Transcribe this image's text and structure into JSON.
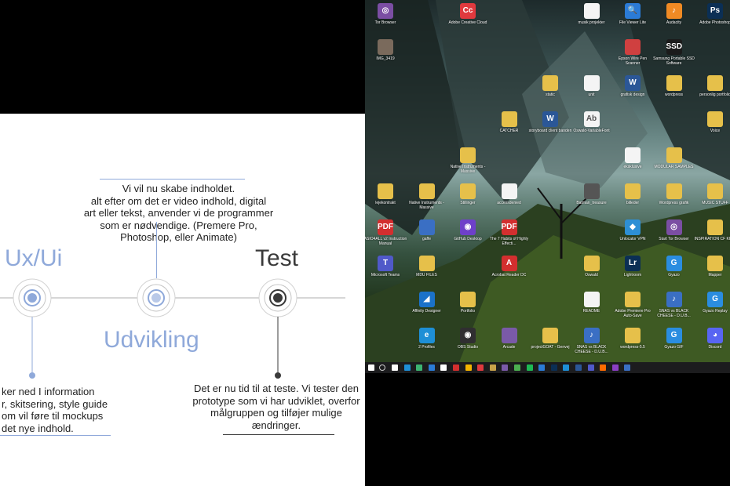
{
  "slide": {
    "top_text": "Vi vil nu skabe indholdet.\nalt efter om det er video indhold, digital\nart eller tekst, anvender vi de programmer\nsom er nødvendige. (Premere Pro,\nPhotoshop, eller Animate)",
    "phase1_title": "Ux/Ui",
    "phase2_title": "Udvikling",
    "phase3_title": "Test",
    "left_text": "ker ned I information\nr, skitsering, style guide\nom vil føre til mockups\n det nye indhold.",
    "right_text": "Det er nu tid til at teste. Vi tester den\nprototype som vi har udviklet, overfor\nmålgruppen og tilføjer mulige\nændringer.",
    "colors": {
      "blue": "#8fa9da",
      "dark": "#3a3a3a",
      "line": "#bfbfbf"
    }
  },
  "desktop": {
    "icons": [
      {
        "label": "Tor Browser",
        "glyph": "◎",
        "type": "app",
        "color": "#7b4ea3"
      },
      {
        "label": "Adobe Creative Cloud",
        "glyph": "Cc",
        "type": "app",
        "color": "#e0393e"
      },
      {
        "label": "musik projekter",
        "glyph": "",
        "type": "doc",
        "color": "#f4f4f4"
      },
      {
        "label": "File Viewer Lite",
        "glyph": "🔍",
        "type": "app",
        "color": "#2b7bd6"
      },
      {
        "label": "Audacity",
        "glyph": "♪",
        "type": "app",
        "color": "#f08a24"
      },
      {
        "label": "Adobe Photoshop",
        "glyph": "Ps",
        "type": "app",
        "color": "#0b2f55"
      },
      {
        "label": "IMG_3419",
        "glyph": "",
        "type": "app",
        "color": "#7a6a5c"
      },
      {
        "label": "Epson Wire Pen Scanner",
        "glyph": "",
        "type": "app",
        "color": "#d04040"
      },
      {
        "label": "Samsung Portable SSD Software",
        "glyph": "SSD",
        "type": "app",
        "color": "#1b1b1b"
      },
      {
        "label": "static",
        "glyph": "",
        "type": "folder",
        "color": "#e6c04a"
      },
      {
        "label": "unit",
        "glyph": "",
        "type": "doc",
        "color": "#f4f4f4"
      },
      {
        "label": "grafisk design",
        "glyph": "W",
        "type": "app",
        "color": "#2b5797"
      },
      {
        "label": "wordpress",
        "glyph": "",
        "type": "folder",
        "color": "#e6c04a"
      },
      {
        "label": "personlig portfolio",
        "glyph": "",
        "type": "folder",
        "color": "#e6c04a"
      },
      {
        "label": "CATCHER",
        "glyph": "",
        "type": "folder",
        "color": "#e6c04a"
      },
      {
        "label": "storyboard client banden",
        "glyph": "W",
        "type": "app",
        "color": "#2b5797"
      },
      {
        "label": "Oswald-VariableFont",
        "glyph": "Ab",
        "type": "doc",
        "color": "#f4f4f4"
      },
      {
        "label": "Voice",
        "glyph": "",
        "type": "folder",
        "color": "#e6c04a"
      },
      {
        "label": "Native Instruments - Massive",
        "glyph": "",
        "type": "folder",
        "color": "#e6c04a"
      },
      {
        "label": "eksklusive",
        "glyph": "",
        "type": "doc",
        "color": "#f4f4f4"
      },
      {
        "label": "MODULAR SAMPLES",
        "glyph": "",
        "type": "folder",
        "color": "#e6c04a"
      },
      {
        "label": "lejekontrakt",
        "glyph": "",
        "type": "folder",
        "color": "#e6c04a"
      },
      {
        "label": "Native Instruments - Massive",
        "glyph": "",
        "type": "folder",
        "color": "#e6c04a"
      },
      {
        "label": "Stillinger",
        "glyph": "",
        "type": "folder",
        "color": "#e6c04a"
      },
      {
        "label": "accessdenied",
        "glyph": "",
        "type": "doc",
        "color": "#f4f4f4"
      },
      {
        "label": "Batman_treasure",
        "glyph": "",
        "type": "app",
        "color": "#555"
      },
      {
        "label": "billeder",
        "glyph": "",
        "type": "folder",
        "color": "#e6c04a"
      },
      {
        "label": "Wordpress grafik",
        "glyph": "",
        "type": "folder",
        "color": "#e6c04a"
      },
      {
        "label": "MUSIC STUFF",
        "glyph": "",
        "type": "folder",
        "color": "#e6c04a"
      },
      {
        "label": "ASIO4ALL v2 Instruction Manual",
        "glyph": "PDF",
        "type": "app",
        "color": "#d32f2f"
      },
      {
        "label": "gaffe",
        "glyph": "",
        "type": "app",
        "color": "#3a6fc4"
      },
      {
        "label": "GitHub Desktop",
        "glyph": "◉",
        "type": "app",
        "color": "#6e40c9"
      },
      {
        "label": "The 7 Habits of Highly Effecti...",
        "glyph": "PDF",
        "type": "app",
        "color": "#d32f2f"
      },
      {
        "label": "Unlocator VPN",
        "glyph": "◆",
        "type": "app",
        "color": "#2d8fd5"
      },
      {
        "label": "Start Tor Browser",
        "glyph": "◎",
        "type": "app",
        "color": "#7b4ea3"
      },
      {
        "label": "INSPIRATION CF KIND",
        "glyph": "",
        "type": "folder",
        "color": "#e6c04a"
      },
      {
        "label": "Microsoft Teams",
        "glyph": "T",
        "type": "app",
        "color": "#5059c9"
      },
      {
        "label": "MDU FILES",
        "glyph": "",
        "type": "folder",
        "color": "#e6c04a"
      },
      {
        "label": "Acrobat Reader DC",
        "glyph": "A",
        "type": "app",
        "color": "#d32f2f"
      },
      {
        "label": "Oswald",
        "glyph": "",
        "type": "folder",
        "color": "#e6c04a"
      },
      {
        "label": "Lightroom",
        "glyph": "Lr",
        "type": "app",
        "color": "#0b2f55"
      },
      {
        "label": "Gyazo",
        "glyph": "G",
        "type": "app",
        "color": "#2a8de0"
      },
      {
        "label": "Mapper",
        "glyph": "",
        "type": "folder",
        "color": "#e6c04a"
      },
      {
        "label": "Affinity Designer",
        "glyph": "◢",
        "type": "app",
        "color": "#1b72c9"
      },
      {
        "label": "Portfolio",
        "glyph": "",
        "type": "folder",
        "color": "#e6c04a"
      },
      {
        "label": "README",
        "glyph": "",
        "type": "doc",
        "color": "#f4f4f4"
      },
      {
        "label": "Adobe Premiere Pro Auto-Save",
        "glyph": "",
        "type": "folder",
        "color": "#e6c04a"
      },
      {
        "label": "SNAS vs BLACK CHEESE - D.U.B...",
        "glyph": "♪",
        "type": "app",
        "color": "#3a6fc4"
      },
      {
        "label": "Gyazo Replay",
        "glyph": "G",
        "type": "app",
        "color": "#2a8de0"
      },
      {
        "label": "2 Profiles",
        "glyph": "e",
        "type": "app",
        "color": "#1e8fd6"
      },
      {
        "label": "OBS Studio",
        "glyph": "◉",
        "type": "app",
        "color": "#302e31"
      },
      {
        "label": "Arcade",
        "glyph": "",
        "type": "app",
        "color": "#7a5aa8"
      },
      {
        "label": "projectGOAT - Genvej",
        "glyph": "",
        "type": "folder",
        "color": "#e6c04a"
      },
      {
        "label": "SNAS vs BLACK CHEESE - D.U.B...",
        "glyph": "♪",
        "type": "app",
        "color": "#3a6fc4"
      },
      {
        "label": "wordpress-5.5",
        "glyph": "",
        "type": "folder",
        "color": "#e6c04a"
      },
      {
        "label": "Gyazo GIF",
        "glyph": "G",
        "type": "app",
        "color": "#2a8de0"
      },
      {
        "label": "Discord",
        "glyph": "◕",
        "type": "app",
        "color": "#5865f2"
      }
    ],
    "taskbar_colors": [
      "#ffffff",
      "#1e8fd6",
      "#3cb371",
      "#2b7bd6",
      "#ffffff",
      "#d32f2f",
      "#f4b400",
      "#e0393e",
      "#c8a24a",
      "#7a5aa8",
      "#4caf50",
      "#1db954",
      "#2b7bd6",
      "#0b2f55",
      "#1e8fd6",
      "#2b5797",
      "#5059c9",
      "#ff6b00",
      "#8a3fc4",
      "#3a6fc4"
    ]
  }
}
